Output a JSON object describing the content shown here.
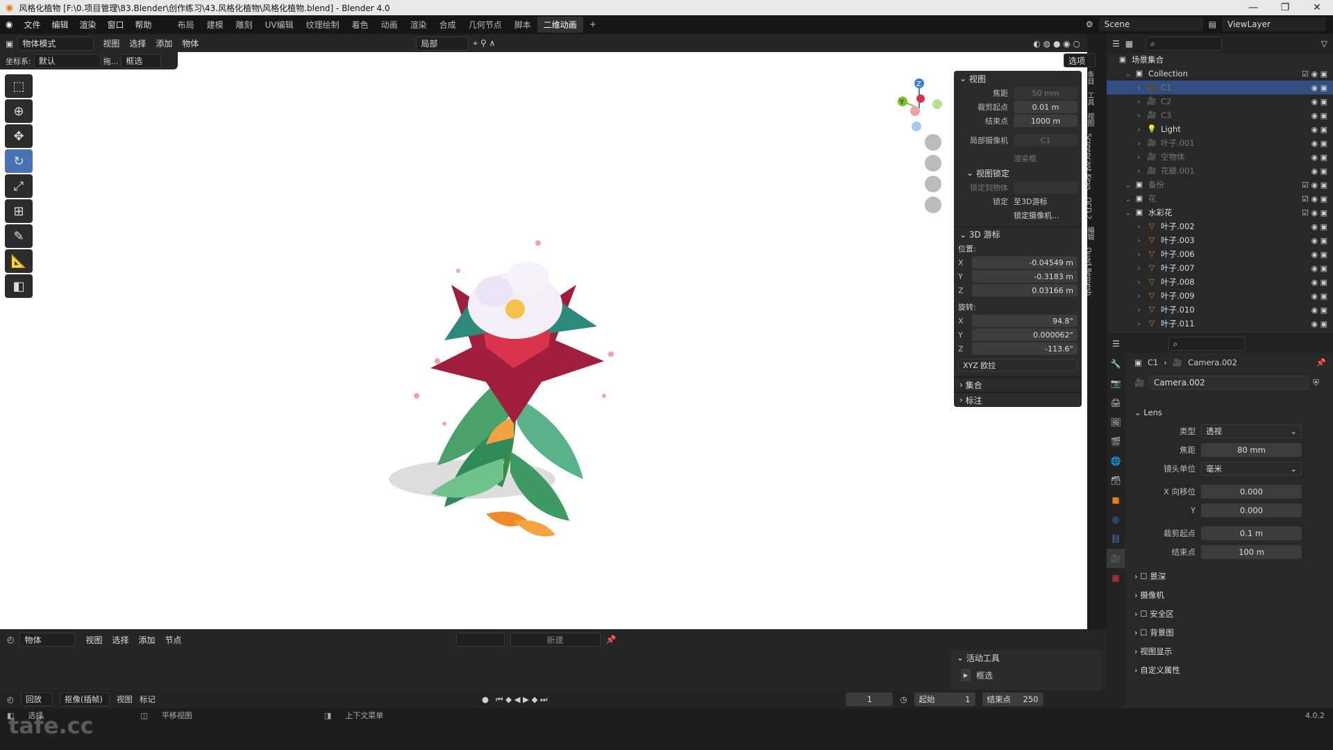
{
  "title": {
    "text": "风格化植物 [F:\\0.项目管理\\83.Blender\\创作练习\\43.风格化植物\\风格化植物.blend] - Blender 4.0"
  },
  "menu": [
    "文件",
    "编辑",
    "渲染",
    "窗口",
    "帮助"
  ],
  "workspaces": [
    "布局",
    "建模",
    "雕刻",
    "UV编辑",
    "纹理绘制",
    "着色",
    "动画",
    "渲染",
    "合成",
    "几何节点",
    "脚本",
    "二维动画"
  ],
  "active_workspace": "二维动画",
  "scene": {
    "scene_name": "Scene",
    "viewlayer": "ViewLayer"
  },
  "viewport_header": {
    "mode": "物体模式",
    "menus": [
      "视图",
      "选择",
      "添加",
      "物体"
    ],
    "pivot": "局部",
    "options": "选项"
  },
  "viewport_header2": {
    "coord_label": "坐标系:",
    "coord_value": "默认",
    "drag": "拖...",
    "select": "框选"
  },
  "npanel": {
    "view_title": "视图",
    "focal_label": "焦距",
    "focal_value": "50 mm",
    "clip_start_label": "裁剪起点",
    "clip_start_value": "0.01 m",
    "clip_end_label": "结束点",
    "clip_end_value": "1000 m",
    "local_cam_label": "局部摄像机",
    "local_cam_value": "C1",
    "render_region": "渲染框",
    "view_lock_title": "视图锁定",
    "lock_obj_label": "锁定到物体",
    "lock_label": "锁定",
    "lock_3d": "至3D游标",
    "lock_cam": "锁定摄像机...",
    "cursor_title": "3D 游标",
    "location_label": "位置:",
    "loc_x": "-0.04549 m",
    "loc_y": "-0.3183 m",
    "loc_z": "0.03166 m",
    "rotation_label": "旋转:",
    "rot_x": "94.8°",
    "rot_y": "0.000062°",
    "rot_z": "-113.6°",
    "rot_mode": "XYZ 欧拉",
    "collection_title": "集合",
    "annotation_title": "标注"
  },
  "side_tabs": [
    "条目",
    "工具",
    "视图",
    "Screencast Keys",
    "OCD 2",
    "编辑",
    "Quad Remesh"
  ],
  "outliner": {
    "scene_collection": "场景集合",
    "rows": [
      {
        "name": "Collection",
        "level": 0,
        "type": "collection",
        "dim": false
      },
      {
        "name": "C1",
        "level": 1,
        "type": "camera",
        "dim": true
      },
      {
        "name": "C2",
        "level": 1,
        "type": "camera",
        "dim": true
      },
      {
        "name": "C3",
        "level": 1,
        "type": "camera",
        "dim": true
      },
      {
        "name": "Light",
        "level": 1,
        "type": "light",
        "dim": false
      },
      {
        "name": "叶子.001",
        "level": 1,
        "type": "camera",
        "dim": true
      },
      {
        "name": "空物体",
        "level": 1,
        "type": "camera",
        "dim": true
      },
      {
        "name": "花瓣.001",
        "level": 1,
        "type": "camera",
        "dim": true
      },
      {
        "name": "备份",
        "level": 0,
        "type": "collection",
        "dim": true
      },
      {
        "name": "花",
        "level": 0,
        "type": "collection",
        "dim": true
      },
      {
        "name": "水彩花",
        "level": 0,
        "type": "collection",
        "dim": false
      },
      {
        "name": "叶子.002",
        "level": 1,
        "type": "mesh",
        "dim": false
      },
      {
        "name": "叶子.003",
        "level": 1,
        "type": "mesh",
        "dim": false
      },
      {
        "name": "叶子.006",
        "level": 1,
        "type": "mesh",
        "dim": false
      },
      {
        "name": "叶子.007",
        "level": 1,
        "type": "mesh",
        "dim": false
      },
      {
        "name": "叶子.008",
        "level": 1,
        "type": "mesh",
        "dim": false
      },
      {
        "name": "叶子.009",
        "level": 1,
        "type": "mesh",
        "dim": false
      },
      {
        "name": "叶子.010",
        "level": 1,
        "type": "mesh",
        "dim": false
      },
      {
        "name": "叶子.011",
        "level": 1,
        "type": "mesh",
        "dim": false
      }
    ]
  },
  "properties": {
    "breadcrumb_obj": "C1",
    "breadcrumb_data": "Camera.002",
    "data_name": "Camera.002",
    "lens_title": "Lens",
    "type_label": "类型",
    "type_value": "透视",
    "focal_label": "焦距",
    "focal_value": "80 mm",
    "unit_label": "镜头单位",
    "unit_value": "毫米",
    "shiftx_label": "X 向移位",
    "shiftx_value": "0.000",
    "shifty_label": "Y",
    "shifty_value": "0.000",
    "clip_start_label": "裁剪起点",
    "clip_start_value": "0.1 m",
    "clip_end_label": "结束点",
    "clip_end_value": "100 m",
    "sections": [
      "景深",
      "摄像机",
      "安全区",
      "背景图",
      "视图显示",
      "自定义属性"
    ]
  },
  "timeline_header": {
    "mode": "物体",
    "menus": [
      "视图",
      "选择",
      "添加",
      "节点"
    ],
    "new": "新建"
  },
  "active_tool": {
    "title": "活动工具",
    "tool": "框选"
  },
  "playback": {
    "playback": "回放",
    "keying": "抠像(插帧)",
    "view": "视图",
    "markers": "标记",
    "frame": "1",
    "start_label": "起始",
    "start": "1",
    "end_label": "结束点",
    "end": "250"
  },
  "status": {
    "select": "选择",
    "pan": "平移视图",
    "context": "上下文菜单",
    "version": "4.0.2",
    "watermark": "tafe.cc"
  }
}
